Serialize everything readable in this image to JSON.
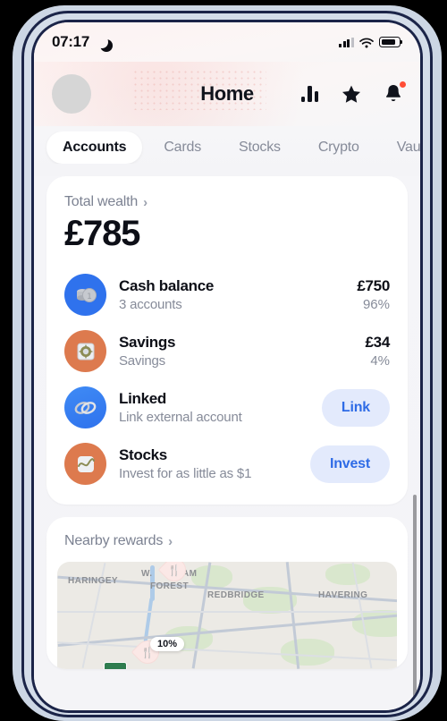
{
  "status_bar": {
    "time": "07:17",
    "dnd_icon": "moon-icon",
    "signal_icon": "cellular-signal-icon",
    "wifi_icon": "wifi-icon",
    "battery_icon": "battery-icon"
  },
  "header": {
    "title": "Home",
    "avatar": "user-avatar",
    "actions": [
      {
        "name": "insights-chart-icon"
      },
      {
        "name": "favourites-star-icon"
      },
      {
        "name": "notifications-bell-icon",
        "has_badge": true
      }
    ]
  },
  "tabs": {
    "items": [
      {
        "label": "Accounts",
        "active": true
      },
      {
        "label": "Cards",
        "active": false
      },
      {
        "label": "Stocks",
        "active": false
      },
      {
        "label": "Crypto",
        "active": false
      },
      {
        "label": "Vau",
        "active": false
      }
    ]
  },
  "wealth_card": {
    "heading": "Total wealth",
    "chevron": "›",
    "amount": "£785",
    "accounts": [
      {
        "title": "Cash balance",
        "subtitle": "3 accounts",
        "amount": "£750",
        "percent": "96%",
        "icon": "coins-icon",
        "icon_bg": "#2f72ed",
        "action": null
      },
      {
        "title": "Savings",
        "subtitle": "Savings",
        "amount": "£34",
        "percent": "4%",
        "icon": "safe-vault-icon",
        "icon_bg": "#dd7a4e",
        "action": null
      },
      {
        "title": "Linked",
        "subtitle": "Link external account",
        "amount": null,
        "percent": null,
        "icon": "chain-link-icon",
        "icon_bg": "#3b86f0",
        "action": "Link"
      },
      {
        "title": "Stocks",
        "subtitle": "Invest for as little as $1",
        "amount": null,
        "percent": null,
        "icon": "stock-chart-icon",
        "icon_bg": "#dd7a4e",
        "action": "Invest"
      }
    ]
  },
  "rewards_card": {
    "heading": "Nearby rewards",
    "chevron": "›",
    "map": {
      "labels": [
        "HARINGEY",
        "W.",
        "AM",
        "FOREST",
        "REDBRIDGE",
        "HAVERING"
      ],
      "offer_badge": "10%",
      "pin_icon": "restaurant-fork-knife-icon"
    }
  },
  "colors": {
    "accent_blue": "#2e6be6",
    "button_bg": "#e3eafc",
    "notification_dot": "#ff4d36",
    "orange_icon": "#dd7a4e",
    "blue_icon": "#2f72ed",
    "text_primary": "#0d0f17",
    "text_secondary": "#868b99"
  }
}
